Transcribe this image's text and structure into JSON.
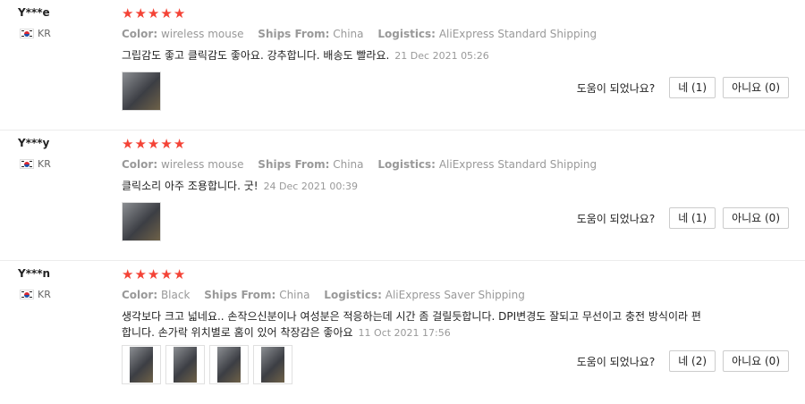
{
  "reviews": [
    {
      "user": "Y***e",
      "country": "KR",
      "stars": [
        "★",
        "★",
        "★",
        "★",
        "★"
      ],
      "color_label": "Color:",
      "color_value": "wireless mouse",
      "ships_label": "Ships From:",
      "ships_value": "China",
      "logistics_label": "Logistics:",
      "logistics_value": "AliExpress Standard Shipping",
      "text": "그립감도 좋고 클릭감도 좋아요. 강추합니다. 배송도 빨라요.",
      "date": "21 Dec 2021 05:26",
      "helpful_question": "도움이 되었나요?",
      "yes_label": "네 (1)",
      "no_label": "아니요 (0)"
    },
    {
      "user": "Y***y",
      "country": "KR",
      "stars": [
        "★",
        "★",
        "★",
        "★",
        "★"
      ],
      "color_label": "Color:",
      "color_value": "wireless mouse",
      "ships_label": "Ships From:",
      "ships_value": "China",
      "logistics_label": "Logistics:",
      "logistics_value": "AliExpress Standard Shipping",
      "text": "클릭소리 아주 조용합니다. 굿!",
      "date": "24 Dec 2021 00:39",
      "helpful_question": "도움이 되었나요?",
      "yes_label": "네 (1)",
      "no_label": "아니요 (0)"
    },
    {
      "user": "Y***n",
      "country": "KR",
      "stars": [
        "★",
        "★",
        "★",
        "★",
        "★"
      ],
      "color_label": "Color:",
      "color_value": "Black",
      "ships_label": "Ships From:",
      "ships_value": "China",
      "logistics_label": "Logistics:",
      "logistics_value": "AliExpress Saver Shipping",
      "text": "생각보다 크고 넓네요.. 손작으신분이나 여성분은 적응하는데 시간 좀 걸릴듯합니다. DPI변경도 잘되고 무선이고 충전 방식이라 편합니다. 손가락 위치별로 홈이 있어 착장감은 좋아요",
      "date": "11 Oct 2021 17:56",
      "helpful_question": "도움이 되었나요?",
      "yes_label": "네 (2)",
      "no_label": "아니요 (0)"
    }
  ]
}
